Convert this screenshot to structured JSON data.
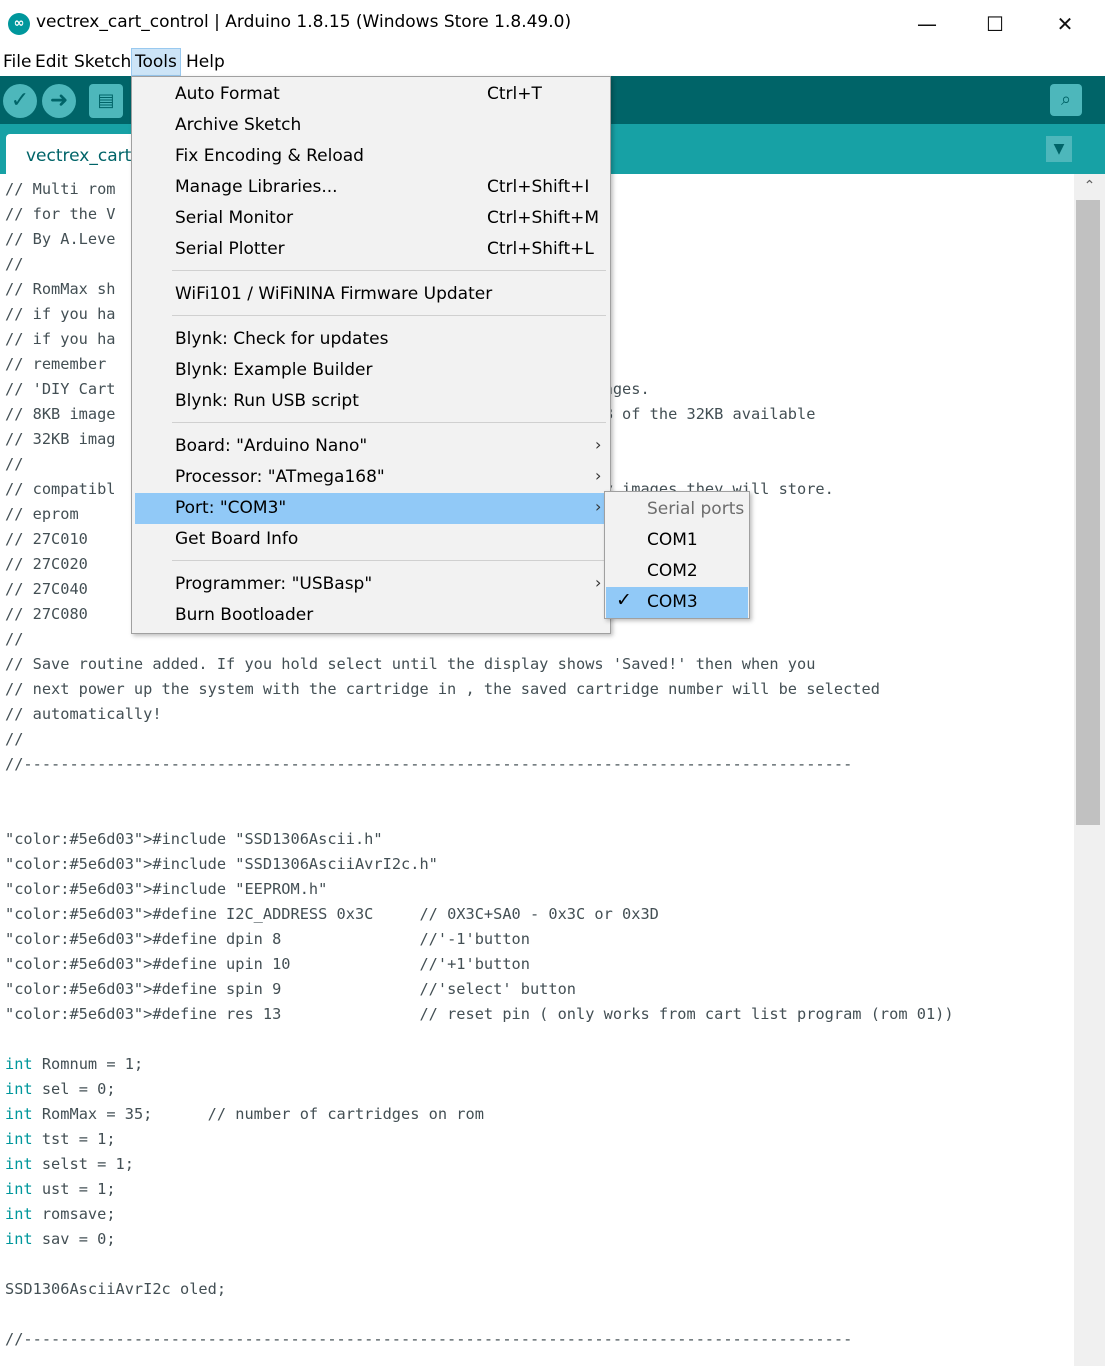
{
  "window": {
    "title": "vectrex_cart_control | Arduino 1.8.15 (Windows Store 1.8.49.0)",
    "minimize": "—",
    "maximize": "☐",
    "close": "✕"
  },
  "menubar": {
    "items": [
      "File",
      "Edit",
      "Sketch",
      "Tools",
      "Help"
    ],
    "active": "Tools"
  },
  "toolbar": {
    "icons": [
      "verify-icon",
      "upload-icon",
      "new-icon",
      "serial-monitor-icon"
    ]
  },
  "tab": {
    "label": "vectrex_cart_",
    "menu_icon": "▼"
  },
  "code_lines": [
    "// Multi rom",
    "// for the V",
    "// By A.Leve",
    "//",
    "// RomMax sh                                          rom.",
    "// if you ha                                          should be 5",
    "// if you ha",
    "// remember                                           DIY Cart+32'",
    "// 'DIY Cart                                          for 32KB images.",
    "// 8KB image                                           take up 8KB of the 32KB available",
    "// 32KB imag",
    "//",
    "// compatibl                                          and how many images they will store.",
    "// eprom",
    "// 27C010",
    "// 27C020",
    "// 27C040",
    "// 27C080",
    "//",
    "// Save routine added. If you hold select until the display shows 'Saved!' then when you",
    "// next power up the system with the cartridge in , the saved cartridge number will be selected",
    "// automatically!",
    "//",
    "//------------------------------------------------------------------------------------------",
    "",
    "",
    "#include \"SSD1306Ascii.h\"",
    "#include \"SSD1306AsciiAvrI2c.h\"",
    "#include \"EEPROM.h\"",
    "#define I2C_ADDRESS 0x3C     // 0X3C+SA0 - 0x3C or 0x3D",
    "#define dpin 8               //'-1'button",
    "#define upin 10              //'+1'button",
    "#define spin 9               //'select' button",
    "#define res 13               // reset pin ( only works from cart list program (rom 01))",
    "",
    "int Romnum = 1;",
    "int sel = 0;",
    "int RomMax = 35;      // number of cartridges on rom",
    "int tst = 1;",
    "int selst = 1;",
    "int ust = 1;",
    "int romsave;",
    "int sav = 0;",
    "",
    "SSD1306AsciiAvrI2c oled;",
    "",
    "//------------------------------------------------------------------------------------------"
  ],
  "tools_menu": [
    {
      "label": "Auto Format",
      "shortcut": "Ctrl+T"
    },
    {
      "label": "Archive Sketch",
      "shortcut": ""
    },
    {
      "label": "Fix Encoding & Reload",
      "shortcut": ""
    },
    {
      "label": "Manage Libraries...",
      "shortcut": "Ctrl+Shift+I"
    },
    {
      "label": "Serial Monitor",
      "shortcut": "Ctrl+Shift+M"
    },
    {
      "label": "Serial Plotter",
      "shortcut": "Ctrl+Shift+L"
    },
    {
      "label": "WiFi101 / WiFiNINA Firmware Updater",
      "shortcut": ""
    },
    {
      "label": "Blynk: Check for updates",
      "shortcut": ""
    },
    {
      "label": "Blynk: Example Builder",
      "shortcut": ""
    },
    {
      "label": "Blynk: Run USB script",
      "shortcut": ""
    },
    {
      "label": "Board: \"Arduino Nano\"",
      "shortcut": "",
      "submenu": true
    },
    {
      "label": "Processor: \"ATmega168\"",
      "shortcut": "",
      "submenu": true
    },
    {
      "label": "Port: \"COM3\"",
      "shortcut": "",
      "submenu": true,
      "selected": true
    },
    {
      "label": "Get Board Info",
      "shortcut": ""
    },
    {
      "label": "Programmer: \"USBasp\"",
      "shortcut": "",
      "submenu": true
    },
    {
      "label": "Burn Bootloader",
      "shortcut": ""
    }
  ],
  "port_submenu": {
    "header": "Serial ports",
    "items": [
      {
        "label": "COM1",
        "checked": false
      },
      {
        "label": "COM2",
        "checked": false
      },
      {
        "label": "COM3",
        "checked": true
      }
    ]
  },
  "colors": {
    "toolbar": "#006468",
    "tabbar": "#17a1a5",
    "keyword": "#00979c",
    "preprocessor": "#5e6d03",
    "string": "#005c5f",
    "comment": "#434f54",
    "menu_highlight": "#91c9f7"
  }
}
